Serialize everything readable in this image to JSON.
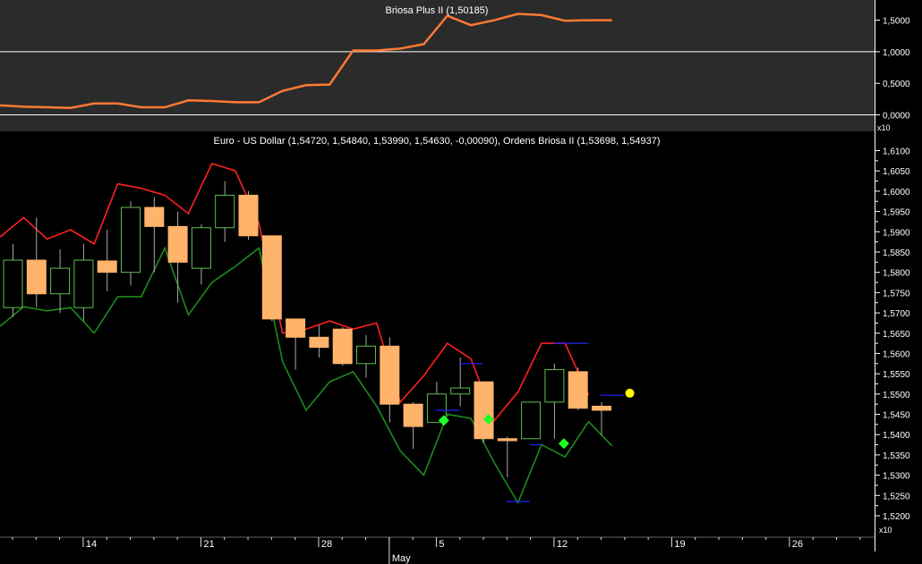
{
  "colors": {
    "background": "#000000",
    "top_panel_bg": "#2b2b2b",
    "indicator_line": "#ff7a33",
    "bull_body": "#000000",
    "bull_outline": "#5fbf4f",
    "bear_body": "#ffb36b",
    "wick": "#aaaaaa",
    "upper_band": "#ff2020",
    "lower_band": "#1d8a1d",
    "stop_line": "#2323ff",
    "signal_marker": "#22ff22",
    "current_marker": "#ffff00",
    "text": "#ffffff"
  },
  "top_panel": {
    "title": "Briosa Plus II (1,50185)",
    "multiplier": "x10",
    "ylim": [
      0,
      1.6
    ],
    "ticks": [
      {
        "value": 0.0,
        "label": "0,0000"
      },
      {
        "value": 0.5,
        "label": "0,5000"
      },
      {
        "value": 1.0,
        "label": "1,0000"
      },
      {
        "value": 1.5,
        "label": "1,5000"
      }
    ]
  },
  "main_panel": {
    "title": "Euro - US Dollar (1,54720, 1,54840, 1,53990, 1,54630, -0,00090), Ordens Briosa II (1,53698, 1,54937)",
    "multiplier": "x10",
    "ylim": [
      1.517,
      1.612
    ],
    "ticks": [
      {
        "value": 1.52,
        "label": "1,5200"
      },
      {
        "value": 1.525,
        "label": "1,5250"
      },
      {
        "value": 1.53,
        "label": "1,5300"
      },
      {
        "value": 1.535,
        "label": "1,5350"
      },
      {
        "value": 1.54,
        "label": "1,5400"
      },
      {
        "value": 1.545,
        "label": "1,5450"
      },
      {
        "value": 1.55,
        "label": "1,5500"
      },
      {
        "value": 1.555,
        "label": "1,5550"
      },
      {
        "value": 1.56,
        "label": "1,5600"
      },
      {
        "value": 1.565,
        "label": "1,5650"
      },
      {
        "value": 1.57,
        "label": "1,5700"
      },
      {
        "value": 1.575,
        "label": "1,5750"
      },
      {
        "value": 1.58,
        "label": "1,5800"
      },
      {
        "value": 1.585,
        "label": "1,5850"
      },
      {
        "value": 1.59,
        "label": "1,5900"
      },
      {
        "value": 1.595,
        "label": "1,5950"
      },
      {
        "value": 1.6,
        "label": "1,6000"
      },
      {
        "value": 1.605,
        "label": "1,6050"
      },
      {
        "value": 1.61,
        "label": "1,6100"
      }
    ]
  },
  "x_axis": {
    "day_labels": [
      {
        "index": 3,
        "label": "14"
      },
      {
        "index": 8,
        "label": "21"
      },
      {
        "index": 13,
        "label": "28"
      },
      {
        "index": 18,
        "label": "5"
      },
      {
        "index": 23,
        "label": "12"
      },
      {
        "index": 28,
        "label": "19"
      },
      {
        "index": 33,
        "label": "26"
      }
    ],
    "month_labels": [
      {
        "index": 16,
        "label": "May"
      }
    ],
    "visible_slots": 36
  },
  "chart_data": [
    {
      "type": "line",
      "title": "Briosa Plus II (1,50185)",
      "x": [
        0,
        1,
        2,
        3,
        4,
        5,
        6,
        7,
        8,
        9,
        10,
        11,
        12,
        13,
        14,
        15,
        16,
        17,
        18,
        19,
        20,
        21,
        22,
        23,
        24,
        25
      ],
      "series": [
        {
          "name": "Briosa Plus II",
          "values": [
            0.15,
            0.13,
            0.12,
            0.11,
            0.18,
            0.18,
            0.12,
            0.12,
            0.23,
            0.22,
            0.2,
            0.2,
            0.38,
            0.47,
            0.48,
            1.02,
            1.02,
            1.05,
            1.12,
            1.57,
            1.42,
            1.5,
            1.6,
            1.58,
            1.49,
            1.5,
            1.5
          ]
        }
      ],
      "ylim": [
        0,
        1.6
      ]
    },
    {
      "type": "candlestick",
      "title": "Euro - US Dollar (1,54720, 1,54840, 1,53990, 1,54630, -0,00090), Ordens Briosa II (1,53698, 1,54937)",
      "x": [
        0,
        1,
        2,
        3,
        4,
        5,
        6,
        7,
        8,
        9,
        10,
        11,
        12,
        13,
        14,
        15,
        16,
        17,
        18,
        19,
        20,
        21,
        22,
        23,
        24,
        25
      ],
      "candles": [
        {
          "open": 1.5713,
          "high": 1.587,
          "low": 1.569,
          "close": 1.583
        },
        {
          "open": 1.583,
          "high": 1.5935,
          "low": 1.5713,
          "close": 1.5747
        },
        {
          "open": 1.5747,
          "high": 1.5857,
          "low": 1.57,
          "close": 1.581
        },
        {
          "open": 1.5713,
          "high": 1.587,
          "low": 1.568,
          "close": 1.583
        },
        {
          "open": 1.5828,
          "high": 1.5905,
          "low": 1.5753,
          "close": 1.58
        },
        {
          "open": 1.58,
          "high": 1.5975,
          "low": 1.5767,
          "close": 1.596
        },
        {
          "open": 1.596,
          "high": 1.5985,
          "low": 1.58,
          "close": 1.5913
        },
        {
          "open": 1.5913,
          "high": 1.595,
          "low": 1.5725,
          "close": 1.5825
        },
        {
          "open": 1.581,
          "high": 1.5918,
          "low": 1.577,
          "close": 1.591
        },
        {
          "open": 1.591,
          "high": 1.6025,
          "low": 1.5875,
          "close": 1.599
        },
        {
          "open": 1.599,
          "high": 1.6,
          "low": 1.588,
          "close": 1.589
        },
        {
          "open": 1.589,
          "high": 1.589,
          "low": 1.568,
          "close": 1.5685
        },
        {
          "open": 1.5685,
          "high": 1.5685,
          "low": 1.556,
          "close": 1.564
        },
        {
          "open": 1.564,
          "high": 1.567,
          "low": 1.559,
          "close": 1.5615
        },
        {
          "open": 1.566,
          "high": 1.5665,
          "low": 1.557,
          "close": 1.5575
        },
        {
          "open": 1.5575,
          "high": 1.5645,
          "low": 1.554,
          "close": 1.5618
        },
        {
          "open": 1.5618,
          "high": 1.564,
          "low": 1.543,
          "close": 1.5475
        },
        {
          "open": 1.5475,
          "high": 1.548,
          "low": 1.5365,
          "close": 1.542
        },
        {
          "open": 1.543,
          "high": 1.553,
          "low": 1.543,
          "close": 1.55
        },
        {
          "open": 1.55,
          "high": 1.559,
          "low": 1.547,
          "close": 1.5515
        },
        {
          "open": 1.553,
          "high": 1.553,
          "low": 1.538,
          "close": 1.539
        },
        {
          "open": 1.539,
          "high": 1.5395,
          "low": 1.5295,
          "close": 1.5385
        },
        {
          "open": 1.539,
          "high": 1.548,
          "low": 1.539,
          "close": 1.548
        },
        {
          "open": 1.548,
          "high": 1.5575,
          "low": 1.539,
          "close": 1.556
        },
        {
          "open": 1.5555,
          "high": 1.5565,
          "low": 1.546,
          "close": 1.5465
        },
        {
          "open": 1.547,
          "high": 1.548,
          "low": 1.54,
          "close": 1.546
        }
      ],
      "overlays": [
        {
          "name": "upper band",
          "color": "#ff2020",
          "values": [
            1.5887,
            1.5935,
            1.5882,
            1.5905,
            1.587,
            1.6018,
            1.6007,
            1.599,
            1.5945,
            1.6068,
            1.605,
            1.592,
            1.565,
            1.566,
            1.568,
            1.566,
            1.5675,
            1.548,
            1.5545,
            1.5625,
            1.5587,
            1.5435,
            1.5505,
            1.5625,
            1.5625,
            1.5497
          ]
        },
        {
          "name": "lower band",
          "color": "#1d8a1d",
          "values": [
            1.5667,
            1.5715,
            1.5705,
            1.5713,
            1.565,
            1.574,
            1.574,
            1.586,
            1.5695,
            1.5775,
            1.5815,
            1.586,
            1.558,
            1.546,
            1.553,
            1.5555,
            1.547,
            1.536,
            1.53,
            1.545,
            1.544,
            1.533,
            1.5232,
            1.5375,
            1.5345,
            1.5432,
            1.5372
          ]
        },
        {
          "name": "stop levels",
          "color": "#2323ff",
          "segments": [
            {
              "x": [
                18.5,
                19.5
              ],
              "value": 1.546
            },
            {
              "x": [
                19.5,
                20.5
              ],
              "value": 1.5575
            },
            {
              "x": [
                21.5,
                22.5
              ],
              "value": 1.5235
            },
            {
              "x": [
                22.5,
                23.0
              ],
              "value": 1.5375
            },
            {
              "x": [
                23.5,
                25.0
              ],
              "value": 1.5625
            },
            {
              "x": [
                25.5,
                26.5
              ],
              "value": 1.5497
            }
          ]
        }
      ],
      "markers": [
        {
          "x": 18.3,
          "value": 1.5435,
          "shape": "diamond",
          "color": "#22ff22"
        },
        {
          "x": 20.2,
          "value": 1.5438,
          "shape": "diamond",
          "color": "#22ff22"
        },
        {
          "x": 23.4,
          "value": 1.5378,
          "shape": "diamond",
          "color": "#22ff22"
        },
        {
          "x": 26.2,
          "value": 1.5502,
          "shape": "circle",
          "color": "#ffff00"
        }
      ],
      "ylim": [
        1.517,
        1.612
      ]
    }
  ]
}
